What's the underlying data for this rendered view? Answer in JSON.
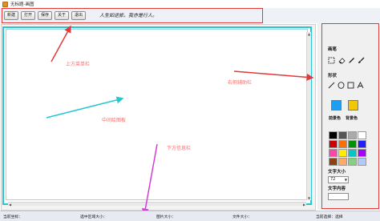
{
  "window": {
    "title": "无标题-画图",
    "icon": "paint-app-icon"
  },
  "menubar": {
    "buttons": [
      "新建",
      "打开",
      "保存",
      "关于",
      "退出"
    ],
    "motto": "人生如逆旅，我亦是行人。"
  },
  "annotations": {
    "top_menu": "上方菜单栏",
    "right_sidebar": "右侧辅助栏",
    "center_canvas": "中间绘图板",
    "bottom_info": "下方信息栏",
    "colors": {
      "red": "#e03a3a",
      "cyan": "#27c7d0",
      "magenta": "#d43cd8"
    }
  },
  "sidebar": {
    "brush_label": "画笔",
    "brush_tools": [
      "select-rect-icon",
      "eraser-icon",
      "pencil-icon",
      "brush-icon"
    ],
    "shape_label": "形状",
    "shape_tools": [
      "line-icon",
      "ellipse-icon",
      "rectangle-icon",
      "text-tool-icon"
    ],
    "fg_color": "#1a9ff2",
    "bg_color": "#f2c800",
    "fg_label": "前景色",
    "bg_label": "背景色",
    "palette": [
      "#000000",
      "#555555",
      "#aaaaaa",
      "#ffffff",
      "#cc0000",
      "#ff6f00",
      "#009000",
      "#2020ff",
      "#ff44aa",
      "#ffee00",
      "#00c8c8",
      "#aa00ff",
      "#8b4513",
      "#ffaa66",
      "#7fd37f",
      "#b3c7ff"
    ],
    "font_size_label": "文字大小",
    "font_size_value": "72",
    "text_content_label": "文字内容"
  },
  "statusbar": {
    "coords": "当前坐标：",
    "selection_size": "选中区域大小：",
    "image_size": "图片大小：",
    "file_size": "文件大小：",
    "current_tool": "当前选择：选择"
  }
}
